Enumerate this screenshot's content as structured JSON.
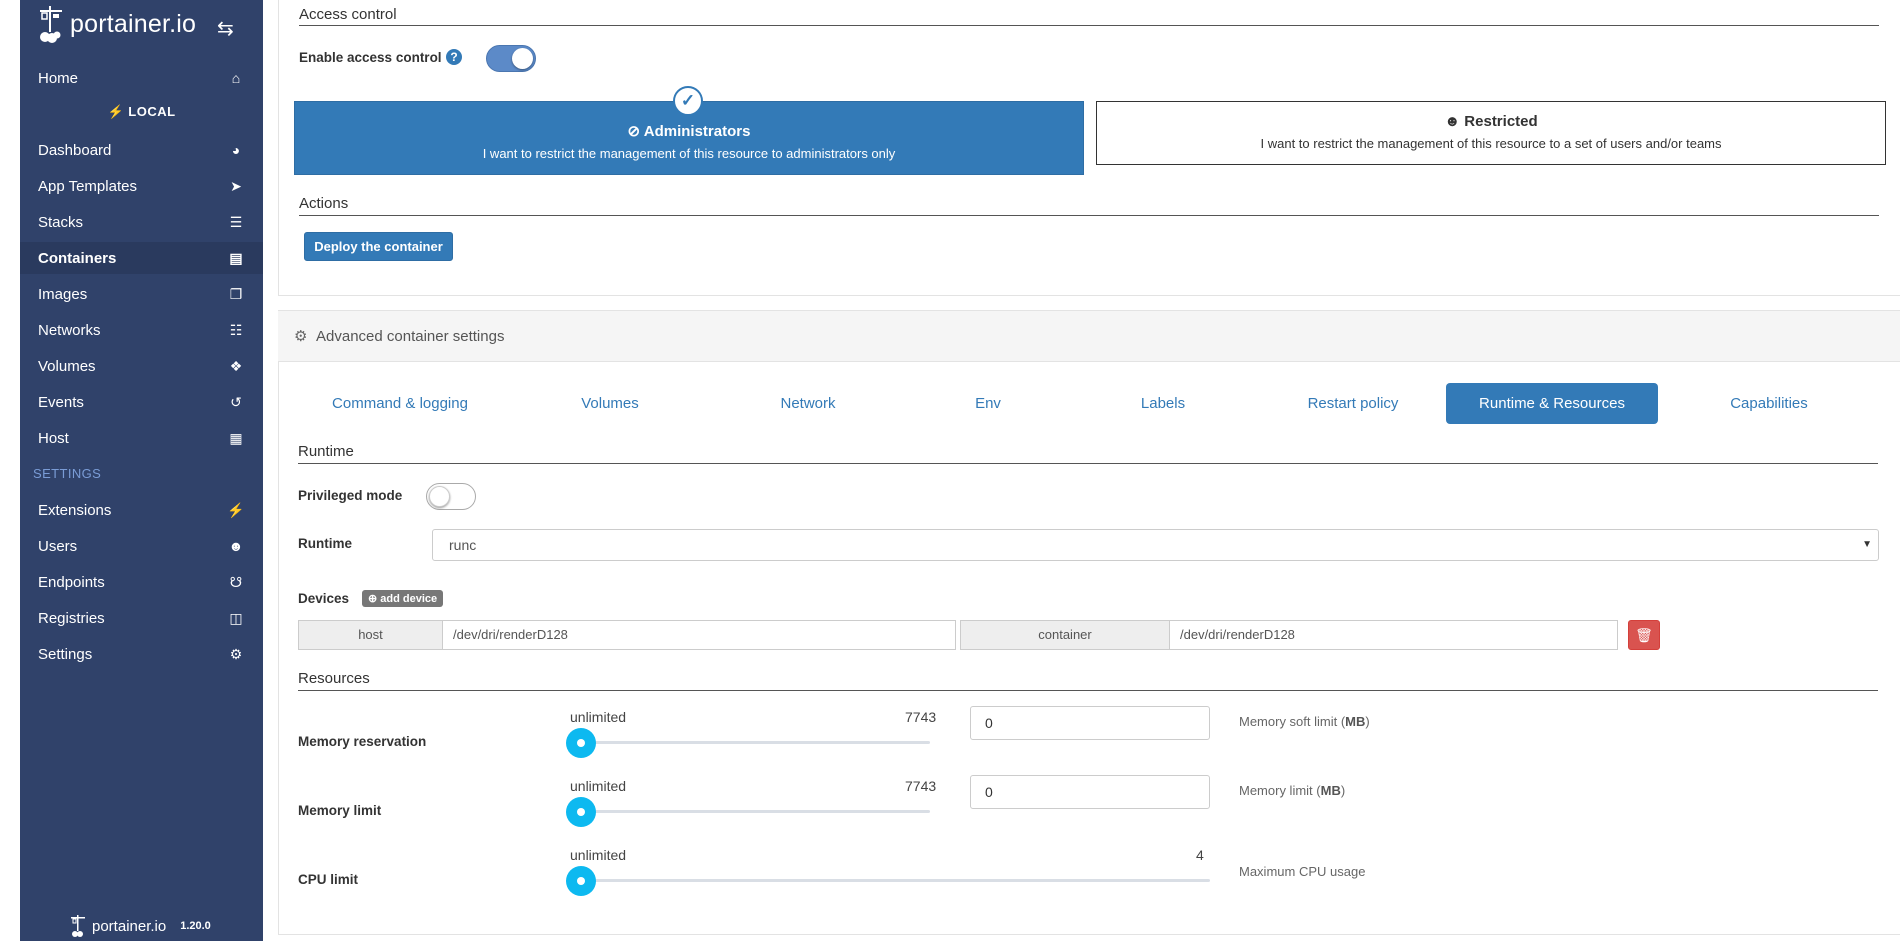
{
  "sidebar": {
    "brand": "portainer.io",
    "endpoint": "LOCAL",
    "items": [
      {
        "label": "Home",
        "icon": "home-icon"
      },
      {
        "label": "Dashboard",
        "icon": "tachometer-icon"
      },
      {
        "label": "App Templates",
        "icon": "rocket-icon"
      },
      {
        "label": "Stacks",
        "icon": "th-list-icon"
      },
      {
        "label": "Containers",
        "icon": "server-icon"
      },
      {
        "label": "Images",
        "icon": "clone-icon"
      },
      {
        "label": "Networks",
        "icon": "sitemap-icon"
      },
      {
        "label": "Volumes",
        "icon": "cubes-icon"
      },
      {
        "label": "Events",
        "icon": "history-icon"
      },
      {
        "label": "Host",
        "icon": "th-icon"
      }
    ],
    "settings_heading": "SETTINGS",
    "settings_items": [
      {
        "label": "Extensions",
        "icon": "bolt-icon"
      },
      {
        "label": "Users",
        "icon": "users-icon"
      },
      {
        "label": "Endpoints",
        "icon": "plug-icon"
      },
      {
        "label": "Registries",
        "icon": "database-icon"
      },
      {
        "label": "Settings",
        "icon": "cogs-icon"
      }
    ],
    "footer_brand": "portainer.io",
    "version": "1.20.0"
  },
  "access_control": {
    "section_title": "Access control",
    "enable_label": "Enable access control",
    "enabled": true,
    "admin_title": "Administrators",
    "admin_desc": "I want to restrict the management of this resource to administrators only",
    "restricted_title": "Restricted",
    "restricted_desc": "I want to restrict the management of this resource to a set of users and/or teams"
  },
  "actions": {
    "section_title": "Actions",
    "deploy_label": "Deploy the container"
  },
  "advanced": {
    "title": "Advanced container settings",
    "tabs": [
      "Command & logging",
      "Volumes",
      "Network",
      "Env",
      "Labels",
      "Restart policy",
      "Runtime & Resources",
      "Capabilities"
    ],
    "active_tab": "Runtime & Resources"
  },
  "runtime": {
    "section_title": "Runtime",
    "privileged_label": "Privileged mode",
    "privileged": false,
    "runtime_label": "Runtime",
    "runtime_value": "runc",
    "devices_label": "Devices",
    "add_device_label": "add device",
    "device": {
      "host_label": "host",
      "host_value": "/dev/dri/renderD128",
      "container_label": "container",
      "container_value": "/dev/dri/renderD128"
    }
  },
  "resources": {
    "section_title": "Resources",
    "memory_reservation": {
      "label": "Memory reservation",
      "min": "unlimited",
      "max": "7743",
      "value": "0",
      "hint": "Memory soft limit (",
      "unit": "MB",
      "hint_end": ")"
    },
    "memory_limit": {
      "label": "Memory limit",
      "min": "unlimited",
      "max": "7743",
      "value": "0",
      "hint": "Memory limit (",
      "unit": "MB",
      "hint_end": ")"
    },
    "cpu_limit": {
      "label": "CPU limit",
      "min": "unlimited",
      "max": "4",
      "hint": "Maximum CPU usage"
    }
  },
  "colors": {
    "sidebar": "#30426a",
    "primary": "#337ab7",
    "danger": "#d9534f",
    "slider": "#0db9f0"
  }
}
